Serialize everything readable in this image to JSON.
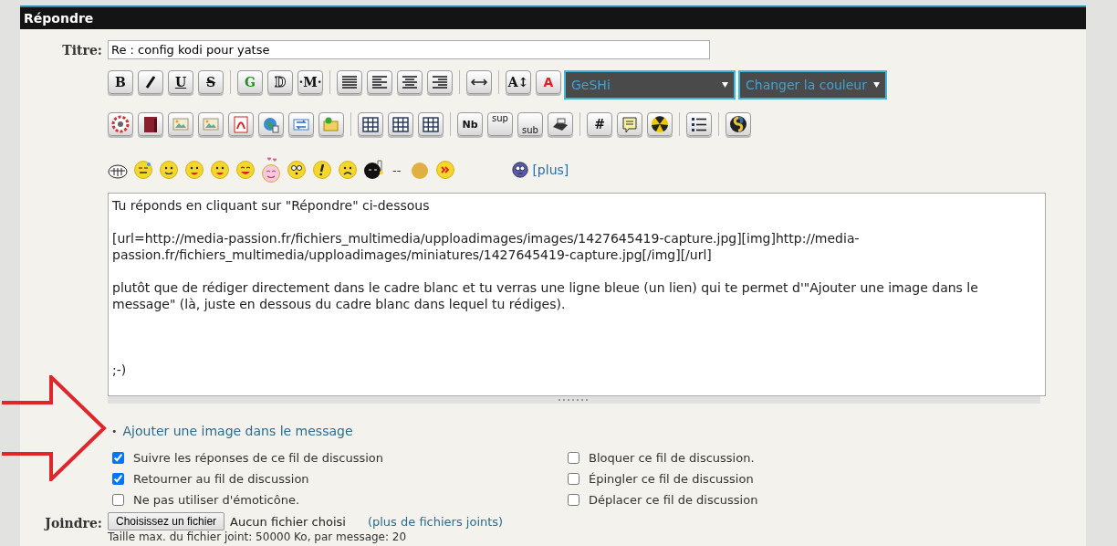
{
  "panel": {
    "title": "Répondre"
  },
  "title_field": {
    "label": "Titre:",
    "value": "Re : config kodi pour yatse"
  },
  "toolbar_rows": [
    [
      {
        "kind": "bold",
        "label": "B"
      },
      {
        "kind": "italic"
      },
      {
        "kind": "underline",
        "label": "U"
      },
      {
        "kind": "strike",
        "label": "S"
      },
      {
        "kind": "sep"
      },
      {
        "kind": "green",
        "label": "G"
      },
      {
        "kind": "outline",
        "label": "D"
      },
      {
        "kind": "bold",
        "label": "·M·"
      },
      {
        "kind": "sep"
      },
      {
        "kind": "justify"
      },
      {
        "kind": "left"
      },
      {
        "kind": "center"
      },
      {
        "kind": "right"
      },
      {
        "kind": "sep"
      },
      {
        "kind": "width"
      },
      {
        "kind": "sep"
      },
      {
        "kind": "bold",
        "label": "A↕"
      },
      {
        "kind": "red",
        "label": "A"
      }
    ],
    [
      {
        "kind": "wheel"
      },
      {
        "kind": "book"
      },
      {
        "kind": "image"
      },
      {
        "kind": "image"
      },
      {
        "kind": "pdf"
      },
      {
        "kind": "globe"
      },
      {
        "kind": "swap"
      },
      {
        "kind": "folder"
      },
      {
        "kind": "sep"
      },
      {
        "kind": "table"
      },
      {
        "kind": "table"
      },
      {
        "kind": "table"
      },
      {
        "kind": "sep"
      },
      {
        "kind": "small",
        "label": "Nb"
      },
      {
        "kind": "sup",
        "label": "sup"
      },
      {
        "kind": "sub",
        "label": "sub"
      },
      {
        "kind": "printer"
      },
      {
        "kind": "sep"
      },
      {
        "kind": "bold",
        "label": "#"
      },
      {
        "kind": "note"
      },
      {
        "kind": "radiation"
      },
      {
        "kind": "sep"
      },
      {
        "kind": "list"
      },
      {
        "kind": "sep"
      },
      {
        "kind": "python"
      }
    ]
  ],
  "dropdowns": [
    {
      "value": "GeSHi"
    },
    {
      "value": "Changer la couleur"
    }
  ],
  "emoticons": [
    {
      "kind": "grin"
    },
    {
      "kind": "sweat"
    },
    {
      "kind": "smile"
    },
    {
      "kind": "tongue"
    },
    {
      "kind": "tongue"
    },
    {
      "kind": "happy"
    },
    {
      "kind": "love"
    },
    {
      "kind": "eek"
    },
    {
      "kind": "exclaim"
    },
    {
      "kind": "sad"
    },
    {
      "kind": "bomb"
    },
    {
      "kind": "text",
      "label": "--"
    },
    {
      "kind": "ball"
    },
    {
      "kind": "forward"
    }
  ],
  "more_emoticons": {
    "label": "[plus]"
  },
  "message": {
    "value": "Tu réponds en cliquant sur \"Répondre\" ci-dessous\n\n[url=http://media-passion.fr/fichiers_multimedia/upploadimages/images/1427645419-capture.jpg][img]http://media-passion.fr/fichiers_multimedia/upploadimages/miniatures/1427645419-capture.jpg[/img][/url]\n\nplutôt que de rédiger directement dans le cadre blanc et tu verras une ligne bleue (un lien) qui te permet d'\"Ajouter une image dans le message\" (là, juste en dessous du cadre blanc dans lequel tu rédiges).\n\n\n\n;-)"
  },
  "add_image": {
    "bullet": "•",
    "label": "Ajouter une image dans le message"
  },
  "options_left": [
    {
      "label": "Suivre les réponses de ce fil de discussion",
      "checked": true
    },
    {
      "label": "Retourner au fil de discussion",
      "checked": true
    },
    {
      "label": "Ne pas utiliser d'émoticône.",
      "checked": false
    }
  ],
  "options_right": [
    {
      "label": "Bloquer ce fil de discussion.",
      "checked": false
    },
    {
      "label": "Épingler ce fil de discussion",
      "checked": false
    },
    {
      "label": "Déplacer ce fil de discussion",
      "checked": false
    }
  ],
  "attach": {
    "label": "Joindre:",
    "button": "Choisissez un fichier",
    "status": "Aucun fichier choisi",
    "more_link": "(plus de fichiers joints)",
    "limit_note": "Taille max. du fichier joint: 50000 Ko, par message: 20"
  }
}
